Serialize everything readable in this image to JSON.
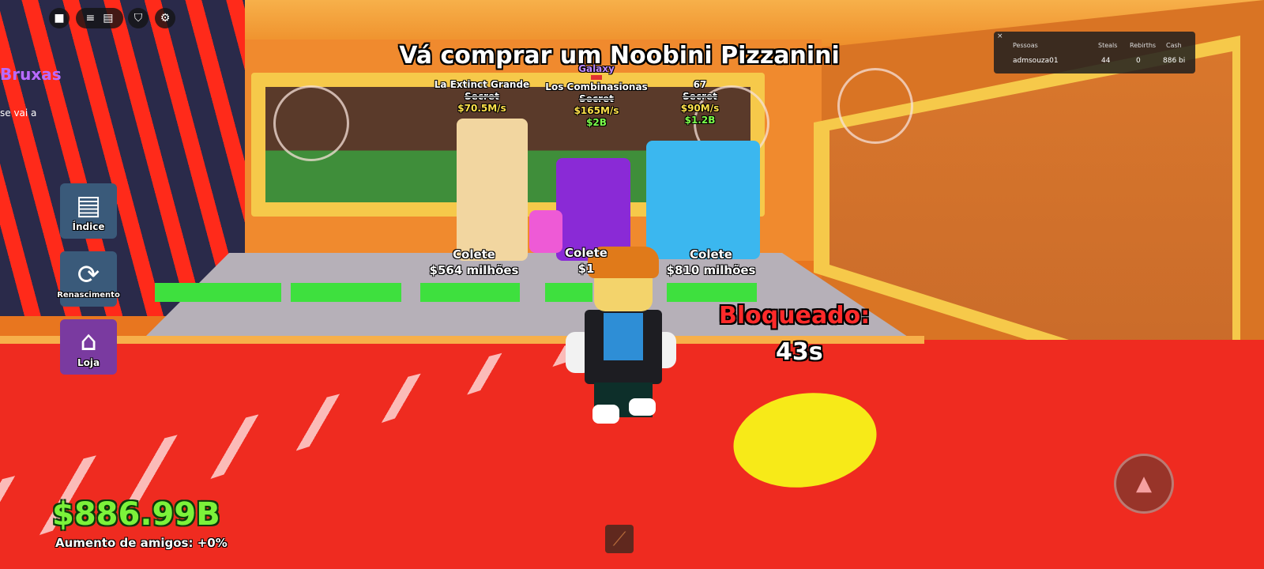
{
  "quest": {
    "text": "Vá comprar um Noobini Pizzanini"
  },
  "brainrots": [
    {
      "name": "La Extinct Grande",
      "rarity": "Secret",
      "rate": "$70.5M/s",
      "price": ""
    },
    {
      "name": "Los Combinasionas",
      "mutation": "Galaxy",
      "rarity": "Secret",
      "rate": "$165M/s",
      "price": "$2B"
    },
    {
      "name": "67",
      "rarity": "Secret",
      "rate": "$90M/s",
      "price": "$1.2B"
    }
  ],
  "collect_labels": [
    {
      "title": "Colete",
      "amount": "$564 milhões"
    },
    {
      "title": "Colete",
      "amount": "$1"
    },
    {
      "title": "Colete",
      "amount": "$810 milhões"
    }
  ],
  "lock": {
    "label": "Bloqueado:",
    "timer": "43s"
  },
  "hud": {
    "money": "$886.99B",
    "friend_boost": "Aumento de amigos: +0%"
  },
  "side_sign": {
    "title": "Bruxas",
    "sub": "se vai a"
  },
  "menu": [
    {
      "label": "Índice",
      "icon": "book-icon",
      "color": "#3a5a7a"
    },
    {
      "label": "Renascimento",
      "icon": "rebirth-icon",
      "color": "#3a5a7a"
    },
    {
      "label": "Loja",
      "icon": "shop-icon",
      "color": "#7a3aa0"
    }
  ],
  "top_bar": {
    "icons": [
      "roblox-logo-icon",
      "menu-icon",
      "chat-icon",
      "backpack-icon",
      "settings-icon"
    ]
  },
  "leaderboard": {
    "headers": [
      "Pessoas",
      "Steals",
      "Rebirths",
      "Cash"
    ],
    "rows": [
      {
        "name": "admsouza01",
        "steals": "44",
        "rebirths": "0",
        "cash": "886 bi"
      }
    ]
  },
  "colors": {
    "money": "#7cf23a",
    "locked": "#ff2a2a",
    "floor": "#ef2b20",
    "pad": "#3ee03e"
  }
}
